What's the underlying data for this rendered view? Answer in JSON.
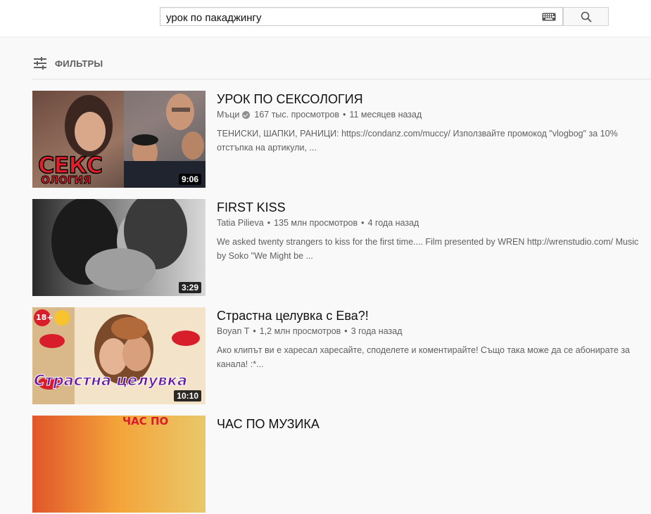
{
  "search": {
    "query": "урок по пакаджингу",
    "keyboard_icon": "keyboard-icon",
    "search_icon": "search-icon"
  },
  "filters": {
    "label": "ФИЛЬТРЫ",
    "icon": "tune-icon"
  },
  "results": [
    {
      "title": "УРОК ПО СЕКСОЛОГИЯ",
      "channel": "Мъци",
      "verified": true,
      "views": "167 тыс. просмотров",
      "age": "11 месяцев назад",
      "description": "ТЕНИСКИ, ШАПКИ, РАНИЦИ: https://condanz.com/muccy/ Използвайте промокод \"vlogbog\" за 10% отстъпка на артикули, ...",
      "duration": "9:06",
      "thumb_text_line1": "СЕКС",
      "thumb_text_line2": "ОЛОГИЯ"
    },
    {
      "title": "FIRST KISS",
      "channel": "Tatia Pilieva",
      "verified": false,
      "views": "135 млн просмотров",
      "age": "4 года назад",
      "description": "We asked twenty strangers to kiss for the first time.... Film presented by WREN http://wrenstudio.com/ Music by Soko \"We Might be ...",
      "duration": "3:29"
    },
    {
      "title": "Страстна целувка с Ева?!",
      "channel": "Boyan T",
      "verified": false,
      "views": "1,2 млн просмотров",
      "age": "3 года назад",
      "description": "Ако клипът ви е харесал харесайте, споделете и коментирайте! Също така може да се абонирате за канала! :*...",
      "duration": "10:10",
      "thumb_badge": "18+",
      "thumb_text": "Страстна целувка"
    },
    {
      "title": "ЧАС ПО МУЗИКА",
      "thumb_text": "ЧАС ПО"
    }
  ],
  "separator": "•"
}
